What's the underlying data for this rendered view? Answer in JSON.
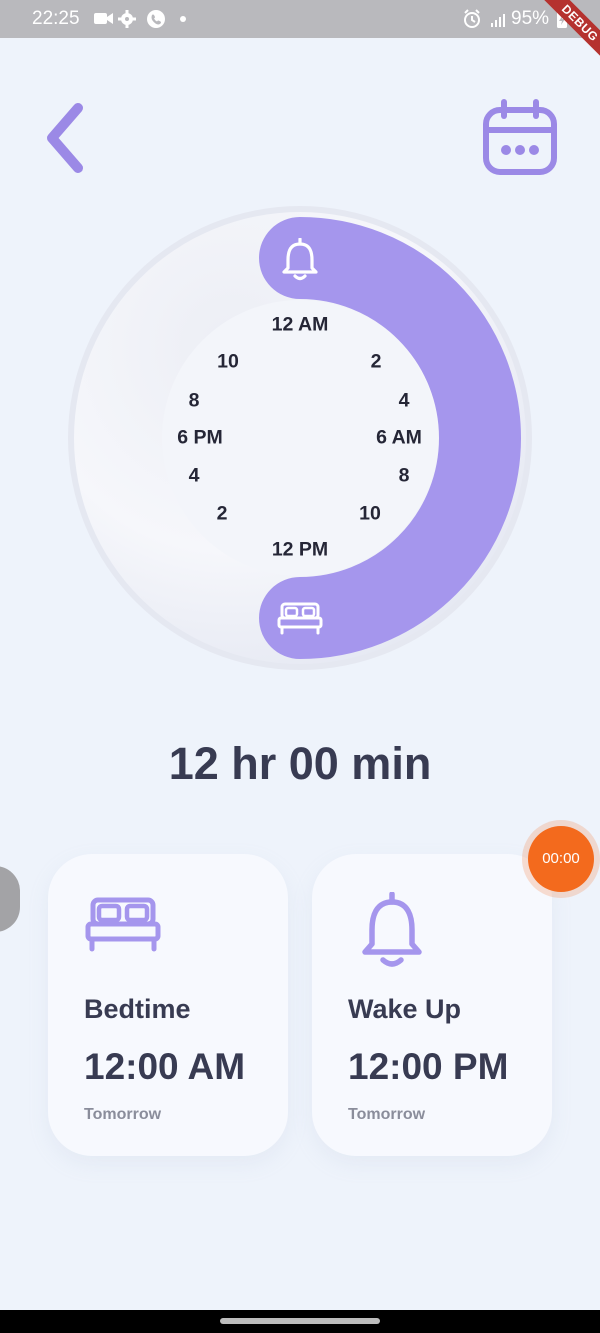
{
  "status_bar": {
    "time": "22:25",
    "battery": "95%",
    "icons_left": [
      "video-call-icon",
      "settings-icon",
      "phone-call-icon",
      "dot-icon"
    ],
    "icons_right": [
      "alarm-icon",
      "signal-icon",
      "battery-charging-icon"
    ]
  },
  "debug_banner": "DEBUG",
  "header": {
    "back_icon": "chevron-left-icon",
    "calendar_icon": "calendar-icon"
  },
  "dial": {
    "hour_labels": [
      "12 AM",
      "2",
      "4",
      "6 AM",
      "8",
      "10",
      "12 PM",
      "2",
      "4",
      "6 PM",
      "8",
      "10"
    ],
    "start_icon": "bell-icon",
    "end_icon": "bed-icon",
    "colors": {
      "arc": "#a596ed",
      "track": "#f3f5fa",
      "icon": "#ffffff"
    }
  },
  "duration": "12 hr 00 min",
  "cards": [
    {
      "icon": "bed-icon",
      "title": "Bedtime",
      "time": "12:00 AM",
      "sub": "Tomorrow"
    },
    {
      "icon": "bell-icon",
      "title": "Wake Up",
      "time": "12:00 PM",
      "sub": "Tomorrow"
    }
  ],
  "timer_fab": "00:00",
  "colors": {
    "accent": "#a596ed",
    "text": "#383b52",
    "fab": "#f36a1d",
    "background": "#eef3fb"
  }
}
